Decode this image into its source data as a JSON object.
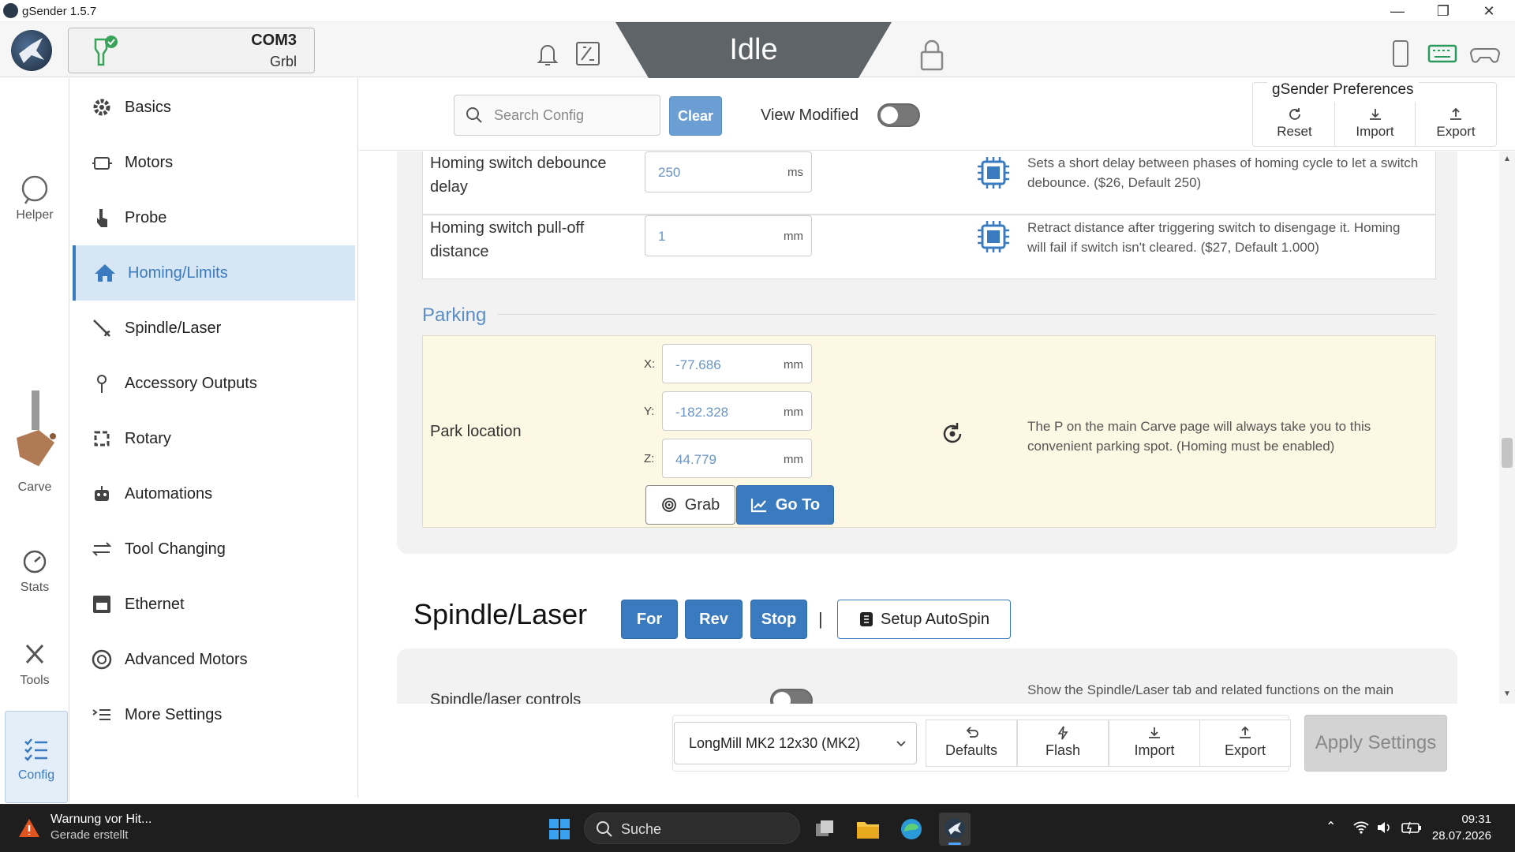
{
  "window": {
    "title": "gSender 1.5.7"
  },
  "header": {
    "port": "COM3",
    "firmware": "Grbl",
    "status": "Idle"
  },
  "rail": {
    "items": [
      {
        "label": "Helper",
        "icon": "chat-bubble-icon"
      },
      {
        "label": "Carve",
        "icon": "router-icon"
      },
      {
        "label": "Stats",
        "icon": "gauge-icon"
      },
      {
        "label": "Tools",
        "icon": "tools-icon"
      },
      {
        "label": "Config",
        "icon": "list-checks-icon"
      }
    ]
  },
  "sidebar": {
    "items": [
      {
        "label": "Basics",
        "icon": "gear-icon"
      },
      {
        "label": "Motors",
        "icon": "motor-icon"
      },
      {
        "label": "Probe",
        "icon": "hand-pointer-icon"
      },
      {
        "label": "Homing/Limits",
        "icon": "home-icon",
        "active": true
      },
      {
        "label": "Spindle/Laser",
        "icon": "laser-icon"
      },
      {
        "label": "Accessory Outputs",
        "icon": "pin-icon"
      },
      {
        "label": "Rotary",
        "icon": "rotary-icon"
      },
      {
        "label": "Automations",
        "icon": "robot-icon"
      },
      {
        "label": "Tool Changing",
        "icon": "arrows-exchange-icon"
      },
      {
        "label": "Ethernet",
        "icon": "ethernet-icon"
      },
      {
        "label": "Advanced Motors",
        "icon": "dial-icon"
      },
      {
        "label": "More Settings",
        "icon": "list-indent-icon"
      }
    ]
  },
  "toolbar": {
    "search_placeholder": "Search Config",
    "clear_label": "Clear",
    "view_modified_label": "View Modified",
    "view_modified_on": false
  },
  "prefs": {
    "title": "gSender Preferences",
    "reset": "Reset",
    "import": "Import",
    "export": "Export"
  },
  "homing": {
    "debounce": {
      "label_line1": "Homing switch debounce",
      "label_line2": "delay",
      "value": "250",
      "unit": "ms",
      "desc_line1": "Sets a short delay between phases of homing cycle to let a switch",
      "desc_line2": "debounce. ($26, Default 250)"
    },
    "pulloff": {
      "label_line1": "Homing switch pull-off",
      "label_line2": "distance",
      "value": "1",
      "unit": "mm",
      "desc_line1": "Retract distance after triggering switch to disengage it. Homing",
      "desc_line2": "will fail if switch isn't cleared. ($27, Default 1.000)"
    }
  },
  "parking": {
    "section_title": "Parking",
    "label": "Park location",
    "x_label": "X:",
    "x_value": "-77.686",
    "y_label": "Y:",
    "y_value": "-182.328",
    "z_label": "Z:",
    "z_value": "44.779",
    "unit": "mm",
    "grab": "Grab",
    "goto": "Go To",
    "desc_line1": "The P on the main Carve page will always take you to this",
    "desc_line2": "convenient parking spot. (Homing must be enabled)"
  },
  "spindle": {
    "title": "Spindle/Laser",
    "for": "For",
    "rev": "Rev",
    "stop": "Stop",
    "separator": "|",
    "autospin": "Setup AutoSpin",
    "row_label": "Spindle/laser controls",
    "row_desc": "Show the Spindle/Laser tab and related functions on the main"
  },
  "bottombar": {
    "machine": "LongMill MK2 12x30 (MK2)",
    "defaults": "Defaults",
    "flash": "Flash",
    "import": "Import",
    "export": "Export",
    "apply": "Apply Settings"
  },
  "taskbar": {
    "notif_title": "Warnung vor Hit...",
    "notif_sub": "Gerade erstellt",
    "search": "Suche",
    "time": "09:31",
    "date": "28.07.2026"
  }
}
